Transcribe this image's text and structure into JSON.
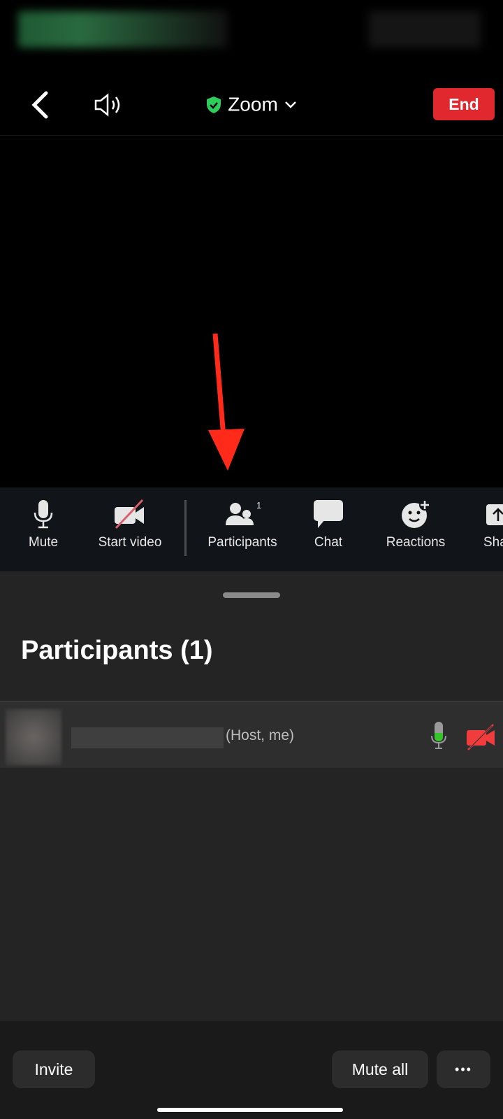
{
  "header": {
    "title": "Zoom",
    "end_label": "End"
  },
  "toolbar": {
    "items": [
      {
        "label": "Mute",
        "icon": "microphone-icon"
      },
      {
        "label": "Start video",
        "icon": "video-off-icon"
      },
      {
        "label": "Participants",
        "icon": "participants-icon",
        "badge": "1"
      },
      {
        "label": "Chat",
        "icon": "chat-icon"
      },
      {
        "label": "Reactions",
        "icon": "reactions-icon"
      },
      {
        "label": "Sha",
        "icon": "share-icon"
      }
    ]
  },
  "panel": {
    "title": "Participants (1)",
    "participants": [
      {
        "role": "(Host, me)",
        "audio": "unmuted",
        "video": "off"
      }
    ]
  },
  "footer": {
    "invite": "Invite",
    "mute_all": "Mute all",
    "more": "•••"
  },
  "colors": {
    "end": "#e0282e",
    "shield": "#2ecc5a",
    "arrow": "#ff2a1a",
    "mic_active": "#35c52a",
    "video_off": "#f03c3c"
  }
}
